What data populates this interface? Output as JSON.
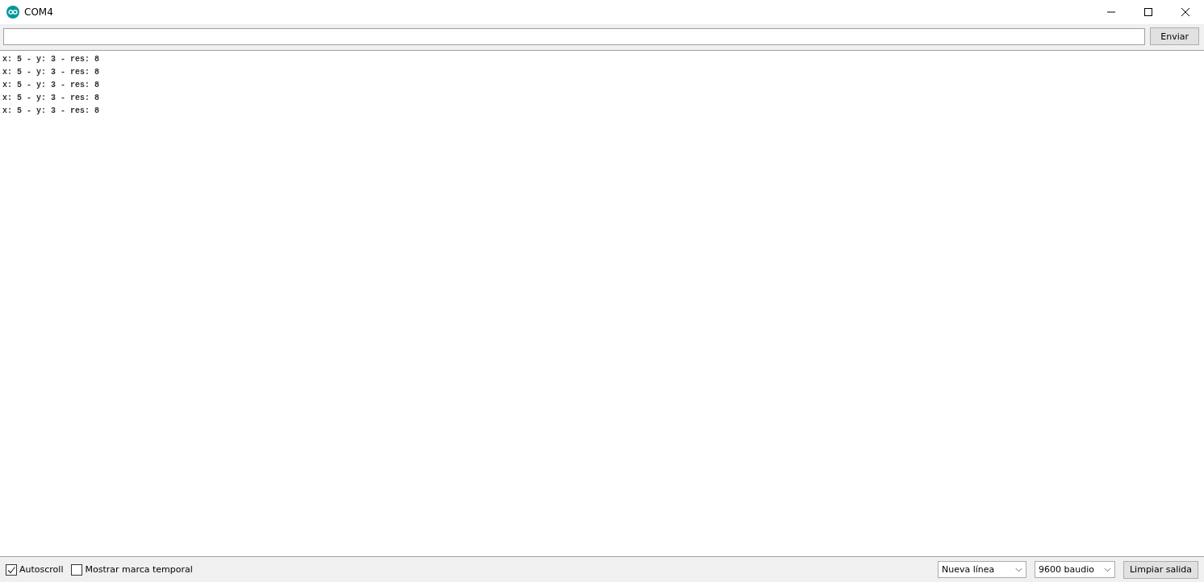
{
  "window": {
    "title": "COM4"
  },
  "send": {
    "button": "Enviar"
  },
  "output": {
    "lines": [
      "x: 5 - y: 3 - res: 8",
      "x: 5 - y: 3 - res: 8",
      "x: 5 - y: 3 - res: 8",
      "x: 5 - y: 3 - res: 8",
      "x: 5 - y: 3 - res: 8"
    ]
  },
  "options": [
    {
      "label": "Autoscroll",
      "checked": true
    },
    {
      "label": "Mostrar marca temporal",
      "checked": false
    }
  ],
  "dropdowns": [
    {
      "value": "Nueva línea"
    },
    {
      "value": "9600 baudio"
    }
  ],
  "clear_button": "Limpiar salida"
}
